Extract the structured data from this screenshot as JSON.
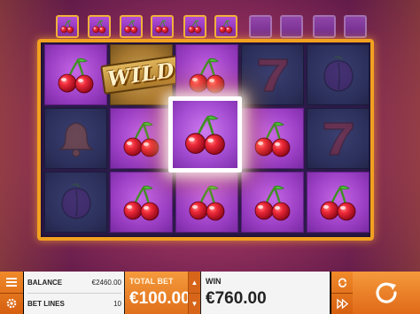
{
  "collection": {
    "slots": [
      {
        "symbol": "cherry",
        "filled": true
      },
      {
        "symbol": "cherry",
        "filled": true
      },
      {
        "symbol": "cherry",
        "filled": true
      },
      {
        "symbol": "cherry",
        "filled": true
      },
      {
        "symbol": "cherry",
        "filled": true
      },
      {
        "symbol": "cherry",
        "filled": true
      },
      {
        "symbol": "empty",
        "filled": false
      },
      {
        "symbol": "empty",
        "filled": false
      },
      {
        "symbol": "empty",
        "filled": false
      },
      {
        "symbol": "empty",
        "filled": false
      }
    ]
  },
  "reels": {
    "wild_label": "WILD",
    "grid": [
      [
        "cherry",
        "wild",
        "cherry",
        "seven",
        "plum"
      ],
      [
        "bell",
        "cherry",
        "cherry",
        "cherry",
        "seven"
      ],
      [
        "plum",
        "cherry",
        "cherry",
        "cherry",
        "cherry"
      ]
    ],
    "dimmed": [
      [
        false,
        false,
        false,
        true,
        true
      ],
      [
        true,
        false,
        false,
        false,
        true
      ],
      [
        true,
        false,
        false,
        false,
        false
      ]
    ]
  },
  "bottom_bar": {
    "balance_label": "BALANCE",
    "balance_value": "€2460.00",
    "bet_lines_label": "BET LINES",
    "bet_lines_value": "10",
    "total_bet_label": "TOTAL BET",
    "total_bet_value": "€100.00",
    "win_label": "WIN",
    "win_value": "€760.00",
    "icons": {
      "menu": "menu-icon",
      "settings": "gear-icon",
      "autoplay": "autoplay-icon",
      "turbo": "fast-forward-icon",
      "spin": "spin-icon"
    }
  },
  "colors": {
    "accent": "#f08a2a",
    "frame": "#f2a020",
    "cherry_red": "#e0182e"
  }
}
